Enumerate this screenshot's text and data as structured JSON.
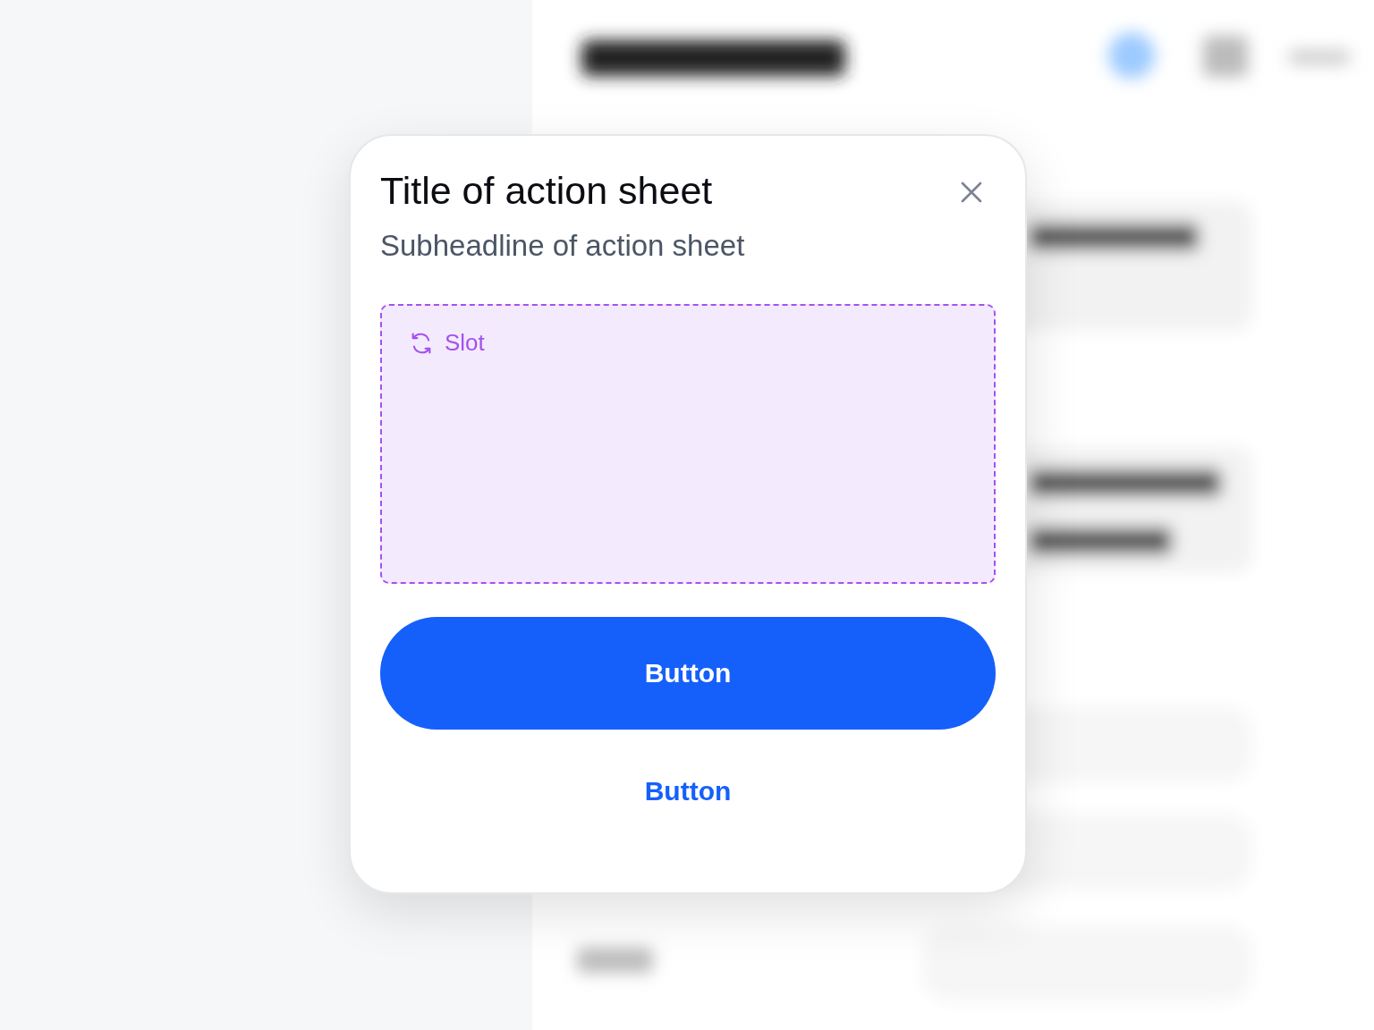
{
  "sheet": {
    "title": "Title of action sheet",
    "subtitle": "Subheadline of action sheet",
    "slot": {
      "label": "Slot"
    },
    "buttons": [
      {
        "label": "Button",
        "kind": "primary"
      },
      {
        "label": "Button",
        "kind": "text"
      }
    ]
  }
}
